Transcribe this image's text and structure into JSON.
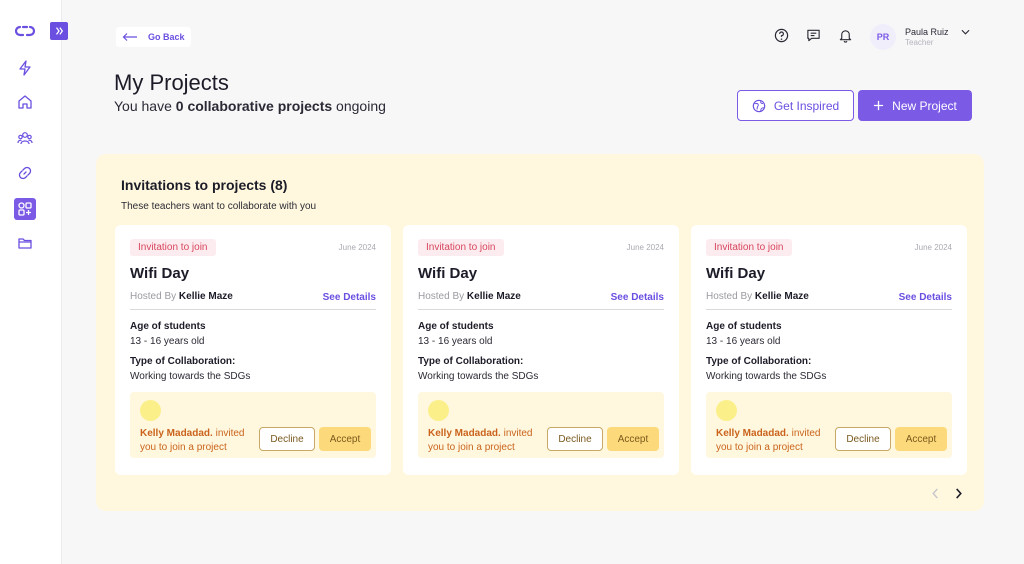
{
  "nav": {
    "back_label": "Go Back",
    "items": [
      {
        "icon": "lightning-icon"
      },
      {
        "icon": "home-icon"
      },
      {
        "icon": "users-icon"
      },
      {
        "icon": "link-icon"
      },
      {
        "icon": "projects-icon",
        "active": true
      },
      {
        "icon": "folder-icon"
      }
    ]
  },
  "user": {
    "initials": "PR",
    "name": "Paula Ruiz",
    "role": "Teacher"
  },
  "header": {
    "title": "My Projects",
    "subtitle_pre": "You have ",
    "subtitle_bold": "0 collaborative projects",
    "subtitle_post": " ongoing",
    "inspired_label": "Get Inspired",
    "new_label": "New Project"
  },
  "invitations": {
    "title": "Invitations to projects (8)",
    "subtitle": "These teachers want to collaborate with you",
    "cards": [
      {
        "tag": "Invitation to join",
        "date": "June 2024",
        "title": "Wifi Day",
        "hosted_label": "Hosted By",
        "host": "Kellie Maze",
        "details_label": "See Details",
        "age_label": "Age of students",
        "age_value": "13 - 16 years old",
        "type_label": "Type of Collaboration:",
        "type_value": "Working towards the SDGs",
        "inviter": "Kelly Madadad.",
        "invite_msg_1": " invited",
        "invite_msg_2": "you to join a project",
        "decline_label": "Decline",
        "accept_label": "Accept"
      },
      {
        "tag": "Invitation to join",
        "date": "June 2024",
        "title": "Wifi Day",
        "hosted_label": "Hosted By",
        "host": "Kellie Maze",
        "details_label": "See Details",
        "age_label": "Age of students",
        "age_value": "13 - 16 years old",
        "type_label": "Type of Collaboration:",
        "type_value": "Working towards the SDGs",
        "inviter": "Kelly Madadad.",
        "invite_msg_1": " invited",
        "invite_msg_2": "you to join a project",
        "decline_label": "Decline",
        "accept_label": "Accept"
      },
      {
        "tag": "Invitation to join",
        "date": "June 2024",
        "title": "Wifi Day",
        "hosted_label": "Hosted By",
        "host": "Kellie Maze",
        "details_label": "See Details",
        "age_label": "Age of students",
        "age_value": "13 - 16 years old",
        "type_label": "Type of Collaboration:",
        "type_value": "Working towards the SDGs",
        "inviter": "Kelly Madadad.",
        "invite_msg_1": " invited",
        "invite_msg_2": "you to join a project",
        "decline_label": "Decline",
        "accept_label": "Accept"
      }
    ]
  },
  "colors": {
    "accent": "#7b5ae6",
    "panel": "#fff8de",
    "tag_text": "#d6455d",
    "invite_text": "#c9631d"
  }
}
